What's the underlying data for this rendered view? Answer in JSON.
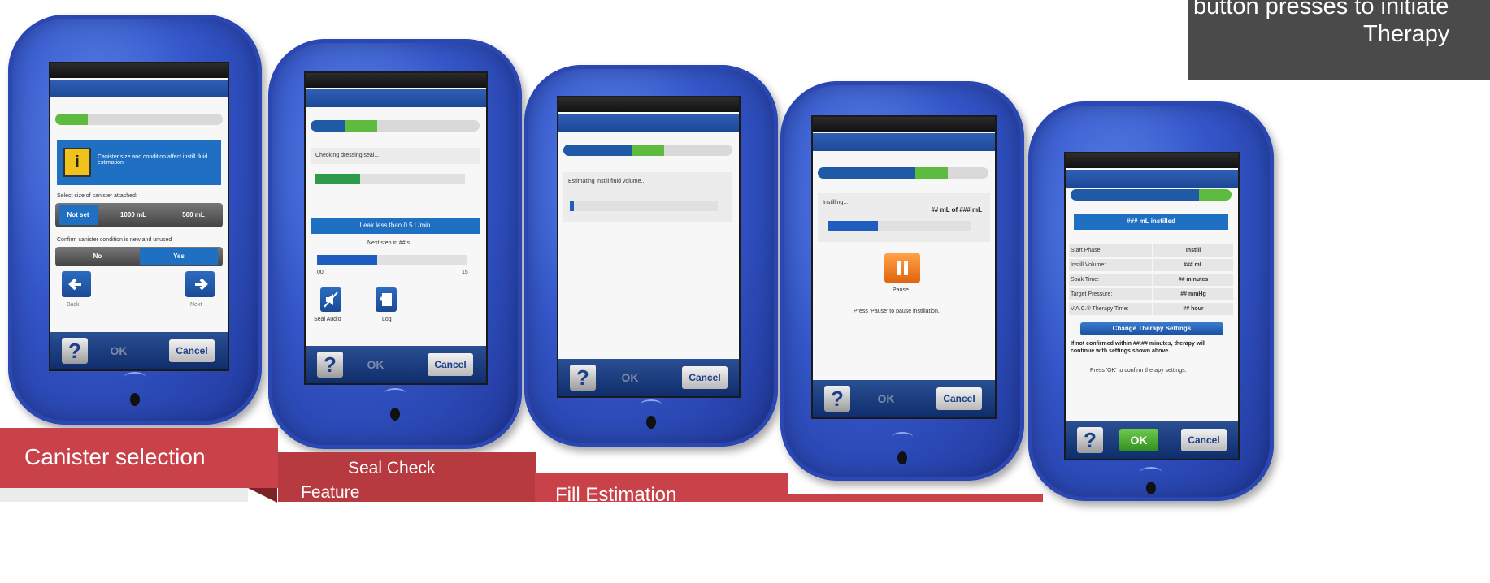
{
  "top_card": {
    "line1": "button presses to initiate",
    "line2": "Therapy"
  },
  "common": {
    "help": "?",
    "ok": "OK",
    "cancel": "Cancel"
  },
  "screen1": {
    "warning_text": "Canister size and condition affect instill fluid estimation",
    "select_label": "Select size of canister attached:",
    "size_options": [
      "Not set",
      "1000 mL",
      "500 mL"
    ],
    "confirm_label": "Confirm canister condition is new and unused",
    "confirm_options": [
      "No",
      "Yes"
    ],
    "back_label": "Back",
    "next_label": "Next",
    "progress_step": 1
  },
  "screen2": {
    "status": "Checking dressing seal...",
    "seal_fill": 0.3,
    "leak_label": "Leak less than 0.5 L/min",
    "next_step": "Next step in ## s",
    "timer_min": "00",
    "timer_max": "15",
    "timer_fill": 0.4,
    "seal_audio_label": "Seal Audio",
    "log_label": "Log"
  },
  "screen3": {
    "status": "Estimating instill fluid volume...",
    "fill": 0.03
  },
  "screen4": {
    "status": "Instilling...",
    "amount": "## mL of ### mL",
    "fill": 0.35,
    "pause_label": "Pause",
    "instruction": "Press 'Pause' to pause instillation."
  },
  "screen5": {
    "header": "### mL instilled",
    "rows": [
      {
        "label": "Start Phase:",
        "value": "Instill"
      },
      {
        "label": "Instill Volume:",
        "value": "### mL"
      },
      {
        "label": "Soak Time:",
        "value": "## minutes"
      },
      {
        "label": "Target Pressure:",
        "value": "## mmHg"
      },
      {
        "label": "V.A.C.® Therapy Time:",
        "value": "## hour"
      }
    ],
    "change_button": "Change Therapy Settings",
    "notice": "If not confirmed within ##:## minutes, therapy will continue with settings shown above.",
    "confirm_text": "Press 'OK' to confirm therapy settings."
  },
  "banners": {
    "canister": "Canister selection",
    "seal_line1": "Seal Check",
    "seal_line2": "Feature",
    "fill": "Fill Estimation"
  },
  "colors": {
    "device_blue": "#3456c9",
    "progress_blue": "#1f5aa6",
    "progress_green": "#5dbb3f",
    "banner_red": "#c9424a",
    "pause_orange": "#f07a18"
  }
}
